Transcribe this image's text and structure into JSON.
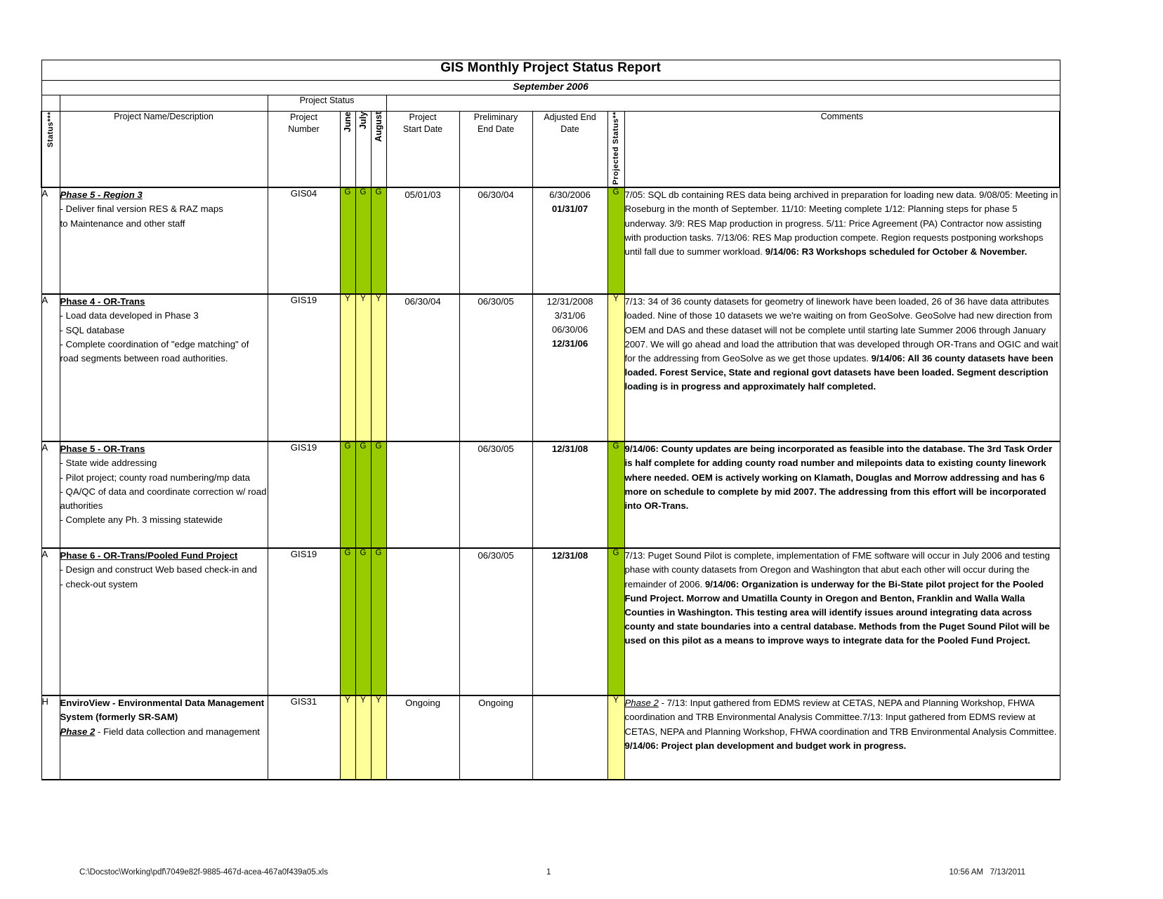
{
  "report": {
    "title": "GIS Monthly Project Status Report",
    "subtitle": "September 2006",
    "group_header": "Project Status"
  },
  "columns": {
    "status": "Status***",
    "name": "Project Name/Description",
    "number_line1": "Project",
    "number_line2": "Number",
    "june": "June",
    "july": "July",
    "august": "August",
    "start_line1": "Project",
    "start_line2": "Start Date",
    "prelim_line1": "Preliminary",
    "prelim_line2": "End Date",
    "adjusted_line1": "Adjusted End",
    "adjusted_line2": "Date",
    "projected": "Projected Status**",
    "comments": "Comments"
  },
  "rows": [
    {
      "status": "A",
      "name_title": "Phase 5 - Region 3",
      "name_lines": [
        " - Deliver final version RES & RAZ maps",
        "to Maintenance and other staff"
      ],
      "number": "GIS04",
      "june": "G",
      "july": "G",
      "august": "G",
      "month_color": "g",
      "start_date": "05/01/03",
      "prelim_end": "06/30/04",
      "adjusted": [
        "6/30/2006"
      ],
      "adjusted_bold": [
        "01/31/07"
      ],
      "projected": "G",
      "projected_color": "g",
      "comments_plain": "7/05: SQL db containing RES data being archived in preparation for loading new data.  9/08/05:  Meeting in Roseburg in the month of September.  11/10: Meeting complete 1/12: Planning steps for phase 5 underway.  3/9: RES Map production in progress. 5/11: Price Agreement (PA) Contractor now assisting with production tasks.  7/13/06: RES Map production compete. Region requests postponing workshops until fall due to summer workload. ",
      "comments_bold": "9/14/06: R3 Workshops scheduled for October & November."
    },
    {
      "status": "A",
      "name_title": "Phase 4 - OR-Trans",
      "name_lines": [
        " - Load data developed in Phase 3",
        " - SQL database",
        "-  Complete coordination of \"edge matching\" of road segments between road authorities."
      ],
      "number": "GIS19",
      "june": "Y",
      "july": "Y",
      "august": "Y",
      "month_color": "y",
      "start_date": "06/30/04",
      "prelim_end": "06/30/05",
      "adjusted": [
        "12/31/2008",
        "3/31/06",
        "06/30/06"
      ],
      "adjusted_bold": [
        "12/31/06"
      ],
      "projected": "Y",
      "projected_color": "y",
      "comments_plain": "7/13: 34 of 36 county datasets for geometry of linework have been loaded, 26 of 36 have data attributes loaded.  Nine of those 10 datasets we we're waiting on from GeoSolve.  GeoSolve had new direction from OEM and DAS and these dataset will not be complete until starting late Summer 2006 through January 2007.  We will go ahead and load the attribution that was developed through OR-Trans and OGIC and wait for the addressing from GeoSolve as we get those updates.  ",
      "comments_bold": "9/14/06: All 36 county datasets have been loaded.  Forest Service, State and regional govt datasets have been loaded.  Segment description loading is in progress and approximately half completed."
    },
    {
      "status": "A",
      "name_title": " Phase 5 - OR-Trans",
      "name_lines": [
        " - State wide addressing",
        " - Pilot project; county road numbering/mp data",
        " - QA/QC of data and coordinate correction w/ road authorities",
        " - Complete any Ph. 3 missing statewide"
      ],
      "number": "GIS19",
      "june": "G",
      "july": "G",
      "august": "G",
      "month_color": "g",
      "start_date": "",
      "prelim_end": "06/30/05",
      "adjusted": [],
      "adjusted_bold": [
        "12/31/08"
      ],
      "projected": "G",
      "projected_color": "g",
      "comments_plain": "",
      "comments_bold": "9/14/06: County updates are being incorporated as feasible into the database.  The 3rd Task Order is half complete for adding county road number and milepoints data to existing county linework where needed.  OEM is actively working on Klamath, Douglas and Morrow addressing and has 6 more on schedule to complete by mid 2007.  The addressing from this effort will be incorporated into OR-Trans."
    },
    {
      "status": "A",
      "name_title": "Phase 6 - OR-Trans/Pooled Fund Project ",
      "name_lines": [
        " - Design and construct Web based check-in and",
        " - check-out system"
      ],
      "number": "GIS19",
      "june": "G",
      "july": "G",
      "august": "G",
      "month_color": "g",
      "start_date": "",
      "prelim_end": "06/30/05",
      "adjusted": [],
      "adjusted_bold": [
        "12/31/08"
      ],
      "projected": "G",
      "projected_color": "g",
      "comments_plain": "7/13: Puget Sound Pilot is complete, implementation of FME software will occur in July 2006 and  testing phase with county datasets from Oregon and Washington that abut each other will occur during the remainder of 2006. ",
      "comments_bold": "9/14/06: Organization is underway for the Bi-State pilot project for the Pooled Fund Project.  Morrow and Umatilla County in Oregon and Benton, Franklin and Walla Walla Counties in Washington.  This testing area will identify issues around integrating data across county and state boundaries into a central database.  Methods from the Puget Sound Pilot will be used on this pilot as a means to improve ways to integrate data for the Pooled Fund Project."
    },
    {
      "status": "H",
      "name_title": "EnviroView - Environmental Data Management System (formerly SR-SAM)",
      "name_phase_label": "Phase 2",
      "name_phase_rest": " - Field data collection and management",
      "name_lines": [],
      "number": "GIS31",
      "june": "Y",
      "july": "Y",
      "august": "Y",
      "month_color": "y",
      "start_date": "Ongoing",
      "prelim_end": "Ongoing",
      "adjusted": [],
      "adjusted_bold": [],
      "projected": "Y",
      "projected_color": "y",
      "comments_phase_label": "Phase 2",
      "comments_plain": " - 7/13: Input gathered from EDMS review at CETAS, NEPA and Planning Workshop, FHWA coordination and TRB Environmental Analysis Committee.7/13: Input gathered from EDMS review at CETAS, NEPA and Planning Workshop, FHWA coordination and TRB Environmental Analysis Committee. ",
      "comments_bold": "9/14/06: Project plan development and budget work in progress."
    }
  ],
  "footer": {
    "path": "C:\\Docstoc\\Working\\pdf\\7049e82f-9885-467d-acea-467a0f439a05.xls",
    "page": "1",
    "time": "10:56 AM",
    "date": "7/13/2011"
  },
  "colors": {
    "green": "#99cc00",
    "yellow": "#ffff99",
    "header_gray": "#c0c0c0"
  }
}
